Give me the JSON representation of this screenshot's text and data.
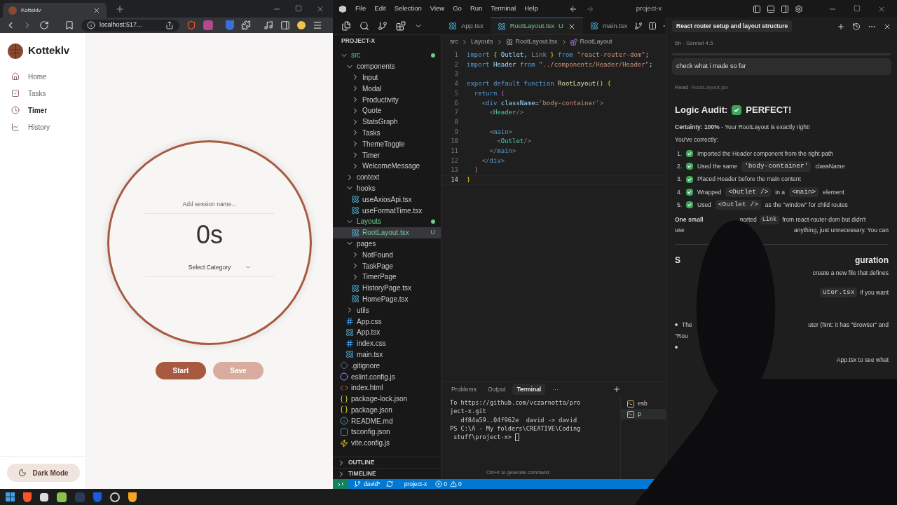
{
  "browser": {
    "tab_title": "Kotteklv",
    "address": "localhost:517...",
    "app": {
      "brand": "Kotteklv",
      "nav": [
        {
          "label": "Home",
          "selected": false
        },
        {
          "label": "Tasks",
          "selected": false
        },
        {
          "label": "Timer",
          "selected": true
        },
        {
          "label": "History",
          "selected": false
        }
      ],
      "session_placeholder": "Add session name...",
      "time": "0s",
      "category": "Select Category",
      "buttons": [
        {
          "label": "Start",
          "disabled": false
        },
        {
          "label": "Save",
          "disabled": true
        }
      ],
      "theme_button": "Dark Mode"
    }
  },
  "vscode": {
    "menu": [
      "File",
      "Edit",
      "Selection",
      "View",
      "Go",
      "Run",
      "Terminal",
      "Help"
    ],
    "title": "project-x",
    "tabs": [
      {
        "label": "App.tsx",
        "selected": false
      },
      {
        "label": "RootLayout.tsx",
        "badge": "U",
        "selected": true
      },
      {
        "label": "main.tsx",
        "selected": false
      }
    ],
    "explorer": {
      "title": "PROJECT-X",
      "tree": [
        {
          "name": "src",
          "kind": "folder",
          "expanded": true,
          "untracked": true,
          "children": [
            {
              "name": "components",
              "kind": "folder",
              "expanded": true,
              "untracked": false,
              "children": [
                {
                  "name": "Input",
                  "kind": "folder",
                  "expanded": false,
                  "untracked": false
                },
                {
                  "name": "Modal",
                  "kind": "folder",
                  "expanded": false,
                  "untracked": false
                },
                {
                  "name": "Productivity",
                  "kind": "folder",
                  "expanded": false,
                  "untracked": false
                },
                {
                  "name": "Quote",
                  "kind": "folder",
                  "expanded": false,
                  "untracked": false
                },
                {
                  "name": "StatsGraph",
                  "kind": "folder",
                  "expanded": false,
                  "untracked": false
                },
                {
                  "name": "Tasks",
                  "kind": "folder",
                  "expanded": false,
                  "untracked": false
                },
                {
                  "name": "ThemeToggle",
                  "kind": "folder",
                  "expanded": false,
                  "untracked": false
                },
                {
                  "name": "Timer",
                  "kind": "folder",
                  "expanded": false,
                  "untracked": false
                },
                {
                  "name": "WelcomeMessage",
                  "kind": "folder",
                  "expanded": false,
                  "untracked": false
                }
              ]
            },
            {
              "name": "context",
              "kind": "folder",
              "expanded": false,
              "untracked": false
            },
            {
              "name": "hooks",
              "kind": "folder",
              "expanded": true,
              "untracked": false,
              "children": [
                {
                  "name": "useAxiosApi.tsx",
                  "kind": "tsx",
                  "untracked": false
                },
                {
                  "name": "useFormatTime.tsx",
                  "kind": "tsx",
                  "untracked": false
                }
              ]
            },
            {
              "name": "Layouts",
              "kind": "folder",
              "expanded": true,
              "untracked": true,
              "children": [
                {
                  "name": "RootLayout.tsx",
                  "kind": "tsx",
                  "untracked": true,
                  "badge": "U",
                  "selected": true
                }
              ]
            },
            {
              "name": "pages",
              "kind": "folder",
              "expanded": true,
              "untracked": false,
              "children": [
                {
                  "name": "NotFound",
                  "kind": "folder",
                  "expanded": false,
                  "untracked": false
                },
                {
                  "name": "TaskPage",
                  "kind": "folder",
                  "expanded": false,
                  "untracked": false
                },
                {
                  "name": "TimerPage",
                  "kind": "folder",
                  "expanded": false,
                  "untracked": false
                },
                {
                  "name": "HistoryPage.tsx",
                  "kind": "tsx",
                  "untracked": false
                },
                {
                  "name": "HomePage.tsx",
                  "kind": "tsx",
                  "untracked": false
                }
              ]
            },
            {
              "name": "utils",
              "kind": "folder",
              "expanded": false,
              "untracked": false
            },
            {
              "name": "App.css",
              "kind": "css",
              "untracked": false
            },
            {
              "name": "App.tsx",
              "kind": "tsx",
              "untracked": false
            },
            {
              "name": "index.css",
              "kind": "css",
              "untracked": false
            },
            {
              "name": "main.tsx",
              "kind": "tsx",
              "untracked": false
            }
          ]
        },
        {
          "name": ".gitignore",
          "kind": "git",
          "untracked": false
        },
        {
          "name": "eslint.config.js",
          "kind": "eslint",
          "untracked": false
        },
        {
          "name": "index.html",
          "kind": "html",
          "untracked": false
        },
        {
          "name": "package-lock.json",
          "kind": "json",
          "untracked": false
        },
        {
          "name": "package.json",
          "kind": "json",
          "untracked": false
        },
        {
          "name": "README.md",
          "kind": "md",
          "untracked": false
        },
        {
          "name": "tsconfig.json",
          "kind": "tsconfig",
          "untracked": false
        },
        {
          "name": "vite.config.js",
          "kind": "vite",
          "untracked": false
        }
      ],
      "sections": [
        {
          "label": "OUTLINE",
          "expanded": false
        },
        {
          "label": "TIMELINE",
          "expanded": false
        }
      ]
    },
    "breadcrumb": [
      "src",
      "Layouts",
      "RootLayout.tsx",
      "RootLayout"
    ],
    "code": [
      {
        "number": "1",
        "current": false,
        "tokens": [
          {
            "t": "import ",
            "kind": "keyword"
          },
          {
            "t": "{ ",
            "kind": "brace"
          },
          {
            "t": "Outlet, ",
            "kind": "name"
          },
          {
            "t": "Link ",
            "kind": "unused"
          },
          {
            "t": "} ",
            "kind": "brace"
          },
          {
            "t": "from ",
            "kind": "keyword"
          },
          {
            "t": "\"react-router-dom\"",
            "kind": "string"
          },
          {
            "t": ";",
            "kind": "punctuation"
          }
        ]
      },
      {
        "number": "2",
        "current": false,
        "tokens": [
          {
            "t": "import ",
            "kind": "keyword"
          },
          {
            "t": "Header ",
            "kind": "name"
          },
          {
            "t": "from ",
            "kind": "keyword"
          },
          {
            "t": "\"../components/Header/Header\"",
            "kind": "string"
          },
          {
            "t": ";",
            "kind": "punctuation"
          }
        ]
      },
      {
        "number": "3",
        "current": false
      },
      {
        "number": "4",
        "current": false,
        "tokens": [
          {
            "t": "export default function ",
            "kind": "keyword"
          },
          {
            "t": "RootLayout",
            "kind": "function"
          },
          {
            "t": "() {",
            "kind": "brace"
          }
        ]
      },
      {
        "number": "5",
        "current": false,
        "tokens": [
          {
            "t": "  return ",
            "kind": "keyword"
          },
          {
            "t": "(",
            "kind": "paren"
          }
        ]
      },
      {
        "number": "6",
        "current": false,
        "tokens": [
          {
            "t": "    <",
            "kind": "angle"
          },
          {
            "t": "div ",
            "kind": "keyword"
          },
          {
            "t": "className",
            "kind": "name"
          },
          {
            "t": "=",
            "kind": "punctuation"
          },
          {
            "t": "'body-container'",
            "kind": "string"
          },
          {
            "t": ">",
            "kind": "angle"
          }
        ]
      },
      {
        "number": "7",
        "current": false,
        "tokens": [
          {
            "t": "      <",
            "kind": "angle"
          },
          {
            "t": "Header",
            "kind": "component"
          },
          {
            "t": "/>",
            "kind": "angle"
          }
        ]
      },
      {
        "number": "8",
        "current": false
      },
      {
        "number": "9",
        "current": false,
        "tokens": [
          {
            "t": "      <",
            "kind": "angle"
          },
          {
            "t": "main",
            "kind": "keyword"
          },
          {
            "t": ">",
            "kind": "angle"
          }
        ]
      },
      {
        "number": "10",
        "current": false,
        "tokens": [
          {
            "t": "        <",
            "kind": "angle"
          },
          {
            "t": "Outlet",
            "kind": "component"
          },
          {
            "t": "/>",
            "kind": "angle"
          }
        ]
      },
      {
        "number": "11",
        "current": false,
        "tokens": [
          {
            "t": "      </",
            "kind": "angle"
          },
          {
            "t": "main",
            "kind": "keyword"
          },
          {
            "t": ">",
            "kind": "angle"
          }
        ]
      },
      {
        "number": "12",
        "current": false,
        "tokens": [
          {
            "t": "    </",
            "kind": "angle"
          },
          {
            "t": "div",
            "kind": "keyword"
          },
          {
            "t": ">",
            "kind": "angle"
          }
        ]
      },
      {
        "number": "13",
        "current": false,
        "tokens": [
          {
            "t": "  )",
            "kind": "paren"
          }
        ]
      },
      {
        "number": "14",
        "current": true,
        "tokens": [
          {
            "t": "}",
            "kind": "brace"
          }
        ]
      }
    ],
    "panel": {
      "tabs": [
        {
          "label": "Problems",
          "selected": false
        },
        {
          "label": "Output",
          "selected": false
        },
        {
          "label": "Terminal",
          "selected": true
        },
        {
          "label": "···",
          "selected": false
        }
      ],
      "lines": [
        "To https://github.com/vczarnotta/pro",
        "ject-x.git",
        "   df84a59..04f962e  david -> david",
        "PS C:\\A - My folders\\CREATIVE\\Coding",
        " stuff\\project-x> "
      ],
      "terminals": [
        "esb",
        "p"
      ],
      "hint": "Ctrl+K to generate command"
    },
    "status": {
      "branch": "david*",
      "project": "project-x",
      "errors": "0",
      "warnings": "0"
    }
  },
  "chat": {
    "title": "React router setup and layout structure",
    "meta": "6h · Sonnet 4.5",
    "user_message": "check what i made so far",
    "read": {
      "label": "Read",
      "file": "RootLayout.jsx"
    },
    "heading": "Logic Audit:",
    "verdict": "PERFECT!",
    "certainty": "**Certainty: 100%** - Your RootLayout is exactly right!",
    "intro": "You've correctly:",
    "items": [
      {
        "number": "1.",
        "parts": [
          {
            "text": "Imported the Header component from the right path",
            "code": false
          }
        ]
      },
      {
        "number": "2.",
        "parts": [
          {
            "text": "Used the same",
            "code": false
          },
          {
            "text": "'body-container'",
            "code": true
          },
          {
            "text": "className",
            "code": false
          }
        ]
      },
      {
        "number": "3.",
        "parts": [
          {
            "text": "Placed Header before the main content",
            "code": false
          }
        ]
      },
      {
        "number": "4.",
        "parts": [
          {
            "text": "Wrapped",
            "code": false
          },
          {
            "text": "<Outlet />",
            "code": true
          },
          {
            "text": "in a",
            "code": false
          },
          {
            "text": "<main>",
            "code": true
          },
          {
            "text": "element",
            "code": false
          }
        ]
      },
      {
        "number": "5.",
        "parts": [
          {
            "text": "Used",
            "code": false
          },
          {
            "text": "<Outlet />",
            "code": true
          },
          {
            "text": "as the \"window\" for child routes",
            "code": false
          }
        ]
      }
    ],
    "note": [
      {
        "text": "One small",
        "code": false
      },
      {
        "text": "ported",
        "code": false
      },
      {
        "text": "Link",
        "code": true
      },
      {
        "text": "from react-router-dom but didn't",
        "code": false
      }
    ],
    "rows": [
      {
        "kind": "text",
        "left": "use",
        "right": [
          {
            "text": "anything, just unnecessary. You can",
            "code": false
          }
        ]
      },
      {
        "kind": "heading",
        "left": "S",
        "right": [
          {
            "text": "guration",
            "code": false
          }
        ]
      },
      {
        "kind": "text",
        "right": [
          {
            "text": "create a new file that defines",
            "code": false
          }
        ]
      },
      {
        "kind": "text",
        "right": [
          {
            "text": "uter.tsx",
            "code": true
          },
          {
            "text": "if you want",
            "code": false
          }
        ]
      },
      {
        "kind": "bullet",
        "left": "The",
        "right": [
          {
            "text": "uter (hint: it has \"Browser\" and",
            "code": false
          }
        ]
      },
      {
        "kind": "text",
        "left": "\"Rou"
      },
      {
        "kind": "bullet"
      },
      {
        "kind": "text",
        "right": [
          {
            "text": "App.tsx to see what",
            "code": false
          }
        ]
      }
    ]
  }
}
